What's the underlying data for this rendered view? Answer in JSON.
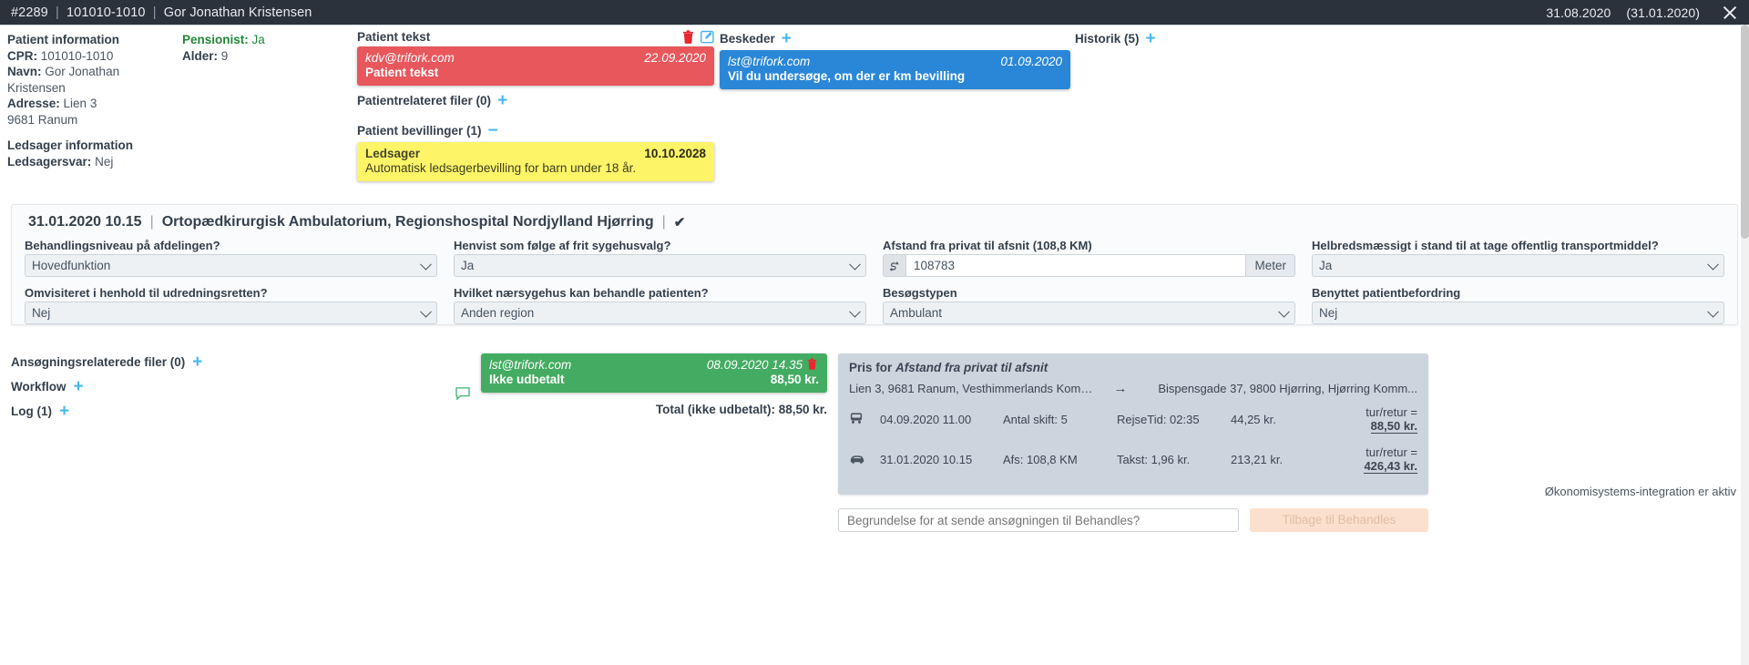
{
  "topbar": {
    "case_id": "#2289",
    "cpr": "101010-1010",
    "name": "Gor Jonathan Kristensen",
    "sep": "|",
    "date_primary": "31.08.2020",
    "date_secondary": "(31.01.2020)",
    "close_icon": "close-icon"
  },
  "patient": {
    "heading": "Patient information",
    "cpr_label": "CPR:",
    "cpr_value": "101010-1010",
    "name_label": "Navn:",
    "name_value": "Gor Jonathan Kristensen",
    "address_label": "Adresse:",
    "address_value": "Lien 3",
    "address_line2": "9681 Ranum",
    "ledsager_heading": "Ledsager information",
    "ledsagersvar_label": "Ledsagersvar:",
    "ledsagersvar_value": "Nej",
    "pensionist_label": "Pensionist:",
    "pensionist_value": "Ja",
    "alder_label": "Alder:",
    "alder_value": "9"
  },
  "patient_tekst": {
    "heading": "Patient tekst",
    "trash_icon": "trash-icon",
    "edit_icon": "edit-icon",
    "note": {
      "from": "kdv@trifork.com",
      "date": "22.09.2020",
      "body": "Patient tekst"
    }
  },
  "patient_filer": {
    "heading": "Patientrelateret filer (0)",
    "plus": "+"
  },
  "bevillinger": {
    "heading": "Patient bevillinger (1)",
    "minus": "−",
    "note": {
      "title": "Ledsager",
      "date": "10.10.2028",
      "body": "Automatisk ledsagerbevilling for barn under 18 år."
    }
  },
  "beskeder": {
    "heading": "Beskeder",
    "plus": "+",
    "note": {
      "from": "lst@trifork.com",
      "date": "01.09.2020",
      "body": "Vil du undersøge, om der er km bevilling"
    }
  },
  "historik": {
    "heading": "Historik (5)",
    "plus": "+"
  },
  "visit": {
    "datetime": "31.01.2020 10.15",
    "sep": "|",
    "location": "Ortopædkirurgisk Ambulatorium, Regionshospital Nordjylland Hjørring",
    "check_icon": "check-icon",
    "fields": [
      {
        "label": "Behandlingsniveau på afdelingen?",
        "value": "Hovedfunktion",
        "type": "select"
      },
      {
        "label": "Henvist som følge af frit sygehusvalg?",
        "value": "Ja",
        "type": "select"
      },
      {
        "label": "Afstand fra privat til afsnit (108,8 KM)",
        "value": "108783",
        "unit": "Meter",
        "type": "input",
        "icon": "route-icon"
      },
      {
        "label": "Helbredsmæssigt i stand til at tage offentlig transportmiddel?",
        "value": "Ja",
        "type": "select"
      },
      {
        "label": "Omvisiteret i henhold til udredningsretten?",
        "value": "Nej",
        "type": "select"
      },
      {
        "label": "Hvilket nærsygehus kan behandle patienten?",
        "value": "Anden region",
        "type": "select"
      },
      {
        "label": "Besøgstypen",
        "value": "Ambulant",
        "type": "select"
      },
      {
        "label": "Benyttet patientbefordring",
        "value": "Nej",
        "type": "select"
      }
    ]
  },
  "lower_links": [
    {
      "label": "Ansøgningsrelaterede filer (0)",
      "plus": "+"
    },
    {
      "label": "Workflow",
      "plus": "+"
    },
    {
      "label": "Log (1)",
      "plus": "+"
    }
  ],
  "payment": {
    "from": "lst@trifork.com",
    "date": "08.09.2020 14.35",
    "trash_icon": "trash-icon",
    "status": "Ikke udbetalt",
    "amount": "88,50 kr.",
    "total": "Total (ikke udbetalt): 88,50 kr."
  },
  "price_panel": {
    "title_prefix": "Pris for ",
    "title_em": "Afstand fra privat til afsnit",
    "from_address": "Lien 3, 9681 Ranum, Vesthimmerlands Kommu...",
    "arrow": "→",
    "to_address": "Bispensgade 37, 9800 Hjørring, Hjørring Komm...",
    "rows": [
      {
        "icon": "bus-icon",
        "datetime": "04.09.2020 11.00",
        "detail1": "Antal skift: 5",
        "detail2": "RejseTid: 02:35",
        "price": "44,25 kr.",
        "roundtrip_label": "tur/retur =",
        "roundtrip_value": "88,50 kr."
      },
      {
        "icon": "car-icon",
        "datetime": "31.01.2020 10.15",
        "detail1": "Afs: 108,8 KM",
        "detail2": "Takst: 1,96 kr.",
        "price": "213,21 kr.",
        "roundtrip_label": "tur/retur =",
        "roundtrip_value": "426,43 kr."
      }
    ]
  },
  "footer": {
    "econ_note": "Økonomisystems-integration er aktiv",
    "reason_placeholder": "Begrundelse for at sende ansøgningen til Behandles?",
    "reason_value": "",
    "back_button": "Tilbage til Behandles"
  }
}
